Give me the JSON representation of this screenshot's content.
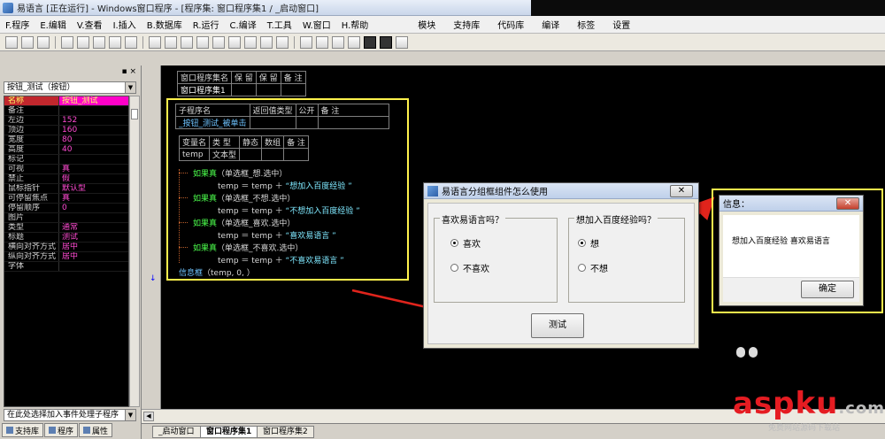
{
  "window": {
    "title": "易语言 [正在运行] - Windows窗口程序 - [程序集: 窗口程序集1 / _启动窗口]"
  },
  "menu": {
    "items": [
      "F.程序",
      "E.编辑",
      "V.查看",
      "I.插入",
      "B.数据库",
      "R.运行",
      "C.编译",
      "T.工具",
      "W.窗口",
      "H.帮助"
    ],
    "right_items": [
      "模块",
      "支持库",
      "代码库",
      "编译",
      "标签",
      "设置"
    ]
  },
  "left_panel": {
    "header": "▪ ×",
    "selected_control": "按钮_测试（按钮）",
    "properties": [
      {
        "name": "名称",
        "value": "按钮_测试"
      },
      {
        "name": "备注",
        "value": ""
      },
      {
        "name": "左边",
        "value": "152"
      },
      {
        "name": "顶边",
        "value": "160"
      },
      {
        "name": "宽度",
        "value": "80"
      },
      {
        "name": "高度",
        "value": "40"
      },
      {
        "name": "标记",
        "value": ""
      },
      {
        "name": "可视",
        "value": "真"
      },
      {
        "name": "禁止",
        "value": "假"
      },
      {
        "name": "鼠标指针",
        "value": "默认型"
      },
      {
        "name": "可停留焦点",
        "value": "真"
      },
      {
        "name": "  停留顺序",
        "value": "0"
      },
      {
        "name": "图片",
        "value": ""
      },
      {
        "name": "类型",
        "value": "通常"
      },
      {
        "name": "标题",
        "value": "测试"
      },
      {
        "name": "横向对齐方式",
        "value": "居中"
      },
      {
        "name": "纵向对齐方式",
        "value": "居中"
      },
      {
        "name": "字体",
        "value": ""
      }
    ],
    "event_selector": "在此处选择加入事件处理子程序",
    "tabs": [
      "支持库",
      "程序",
      "属性"
    ]
  },
  "editor": {
    "assembly_table": {
      "headers": [
        "窗口程序集名",
        "保 留",
        "保 留",
        "备 注"
      ],
      "row": [
        "窗口程序集1",
        "",
        "",
        ""
      ]
    },
    "sub_table": {
      "headers": [
        "子程序名",
        "返回值类型",
        "公开",
        "备 注"
      ],
      "row": [
        "_按钮_测试_被单击",
        "",
        "",
        ""
      ]
    },
    "var_table": {
      "headers": [
        "变量名",
        "类 型",
        "静态",
        "数组",
        "备 注"
      ],
      "row": [
        "temp",
        "文本型",
        "",
        "",
        ""
      ]
    },
    "code_lines": [
      {
        "kw": "如果真",
        "rest": "（单选框_想.选中）"
      },
      {
        "kw": "",
        "rest": "temp ＝ temp ＋ ",
        "str": "“想加入百度经验  ”"
      },
      {
        "kw": "如果真",
        "rest": "（单选框_不想.选中）"
      },
      {
        "kw": "",
        "rest": "temp ＝ temp ＋ ",
        "str": "“不想加入百度经验  ”"
      },
      {
        "kw": "如果真",
        "rest": "（单选框_喜欢.选中）"
      },
      {
        "kw": "",
        "rest": "temp ＝ temp ＋ ",
        "str": "“喜欢易语言  ”"
      },
      {
        "kw": "如果真",
        "rest": "（单选框_不喜欢.选中）"
      },
      {
        "kw": "",
        "rest": "temp ＝ temp ＋ ",
        "str": "“不喜欢易语言  ”"
      }
    ],
    "last_line": {
      "fn": "信息框",
      "args": "（temp, 0, ）"
    }
  },
  "dialog_main": {
    "title": "易语言分组框组件怎么使用",
    "group1": {
      "label": "喜欢易语言吗？",
      "opt1": "喜欢",
      "opt2": "不喜欢"
    },
    "group2": {
      "label": "想加入百度经验吗？",
      "opt1": "想",
      "opt2": "不想"
    },
    "button": "测试",
    "close": "✕"
  },
  "dialog_info": {
    "title": "信息：",
    "message": "想加入百度经验  喜欢易语言",
    "ok": "确定",
    "close": "✕"
  },
  "bottom_tabs": [
    "_启动窗口",
    "窗口程序集1",
    "窗口程序集2"
  ],
  "watermark": {
    "main": "aspku",
    "suffix": ".com",
    "sub": "免费网站源码下载站"
  },
  "colors": {
    "accent_yellow": "#fff24c",
    "arrow_red": "#e0241c",
    "keyword_green": "#4cff4c",
    "string_cyan": "#7fe9ff",
    "prop_value_pink": "#ff4bd2"
  }
}
